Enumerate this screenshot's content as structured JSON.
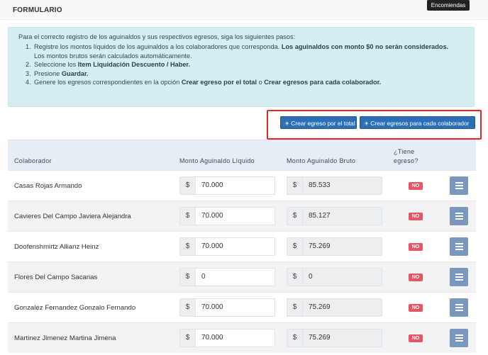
{
  "header": {
    "title": "FORMULARIO",
    "tooltip": "Encomiendas"
  },
  "alert": {
    "intro": "Para el correcto registro de los aguinaldos y sus respectivos egresos, siga los siguientes pasos:",
    "steps": [
      {
        "num": "1.",
        "parts": [
          {
            "text": "Registre los montos líquidos de los aguinaldos a los colaboradores que corresponda. ",
            "bold": false
          },
          {
            "text": "Los aguinaldos con monto $0 no serán considerados.",
            "bold": true
          }
        ],
        "line2": "Los montos brutos serán calculados automáticamente."
      },
      {
        "num": "2.",
        "parts": [
          {
            "text": "Seleccione los ",
            "bold": false
          },
          {
            "text": "Item Liquidación Descuento / Haber.",
            "bold": true
          }
        ]
      },
      {
        "num": "3.",
        "parts": [
          {
            "text": "Presione ",
            "bold": false
          },
          {
            "text": "Guardar.",
            "bold": true
          }
        ]
      },
      {
        "num": "4.",
        "parts": [
          {
            "text": "Genere los egresos correspondientes en la opción ",
            "bold": false
          },
          {
            "text": "Crear egreso por el total",
            "bold": true
          },
          {
            "text": " o ",
            "bold": false
          },
          {
            "text": "Crear egresos para cada colaborador.",
            "bold": true
          }
        ]
      }
    ]
  },
  "actions": {
    "create_total": "Crear egreso por el total",
    "create_each": "Crear egresos para cada colaborador"
  },
  "table": {
    "columns": {
      "colaborador": "Colaborador",
      "liquido": "Monto Aguinaldo Líquido",
      "bruto": "Monto Aguinaldo Bruto",
      "egreso_line1": "¿Tiene",
      "egreso_line2": "egreso?"
    },
    "currency": "$",
    "rows": [
      {
        "name": "Casas Rojas Armando",
        "liquido": "70.000",
        "bruto": "85.533",
        "egreso": "NO"
      },
      {
        "name": "Cavieres Del Campo Javiera Alejandra",
        "liquido": "70.000",
        "bruto": "85.127",
        "egreso": "NO"
      },
      {
        "name": "Doofenshmirtz Allianz Heinz",
        "liquido": "70.000",
        "bruto": "75.269",
        "egreso": "NO"
      },
      {
        "name": "Flores Del Campo Sacarias",
        "liquido": "0",
        "bruto": "0",
        "egreso": "NO"
      },
      {
        "name": "Gonzalez Fernandez Gonzalo Fernando",
        "liquido": "70.000",
        "bruto": "75.269",
        "egreso": "NO"
      },
      {
        "name": "Martinez Jimenez Martina Jimena",
        "liquido": "70.000",
        "bruto": "75.269",
        "egreso": "NO"
      }
    ]
  },
  "colors": {
    "primary": "#2d6fb5",
    "danger": "#e85565",
    "info_bg": "#d5eef1",
    "action_gray": "#7a98bd",
    "highlight": "#e3242b"
  }
}
